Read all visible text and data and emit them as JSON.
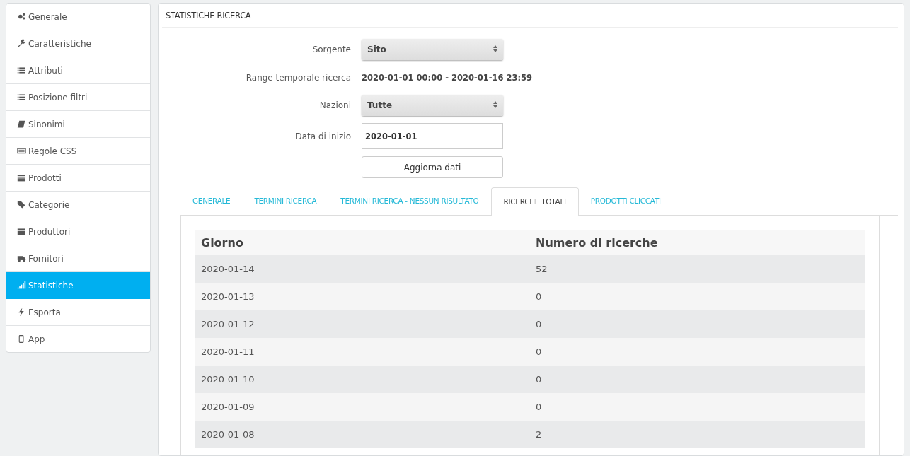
{
  "sidebar": {
    "items": [
      {
        "label": "Generale",
        "selected": false
      },
      {
        "label": "Caratteristiche",
        "selected": false
      },
      {
        "label": "Attributi",
        "selected": false
      },
      {
        "label": "Posizione filtri",
        "selected": false
      },
      {
        "label": "Sinonimi",
        "selected": false
      },
      {
        "label": "Regole CSS",
        "selected": false
      },
      {
        "label": "Prodotti",
        "selected": false
      },
      {
        "label": "Categorie",
        "selected": false
      },
      {
        "label": "Produttori",
        "selected": false
      },
      {
        "label": "Fornitori",
        "selected": false
      },
      {
        "label": "Statistiche",
        "selected": true
      },
      {
        "label": "Esporta",
        "selected": false
      },
      {
        "label": "App",
        "selected": false
      }
    ]
  },
  "panel": {
    "title": "STATISTICHE RICERCA",
    "form": [
      {
        "kind": "select",
        "label": "Sorgente",
        "value": "Sito"
      },
      {
        "kind": "static",
        "label": "Range temporale ricerca",
        "value": "2020-01-01 00:00 - 2020-01-16 23:59"
      },
      {
        "kind": "select",
        "label": "Nazioni",
        "value": "Tutte"
      },
      {
        "kind": "input",
        "label": "Data di inizio",
        "value": "2020-01-01"
      },
      {
        "kind": "button",
        "label": "Aggiorna dati"
      }
    ],
    "tabs": [
      {
        "label": "GENERALE",
        "selected": false
      },
      {
        "label": "TERMINI RICERCA",
        "selected": false
      },
      {
        "label": "TERMINI RICERCA - NESSUN RISULTATO",
        "selected": false
      },
      {
        "label": "RICERCHE TOTALI",
        "selected": true
      },
      {
        "label": "PRODOTTI CLICCATI",
        "selected": false
      }
    ],
    "table": {
      "columns": [
        "Giorno",
        "Numero di ricerche"
      ],
      "rows": [
        [
          "2020-01-14",
          "52"
        ],
        [
          "2020-01-13",
          "0"
        ],
        [
          "2020-01-12",
          "0"
        ],
        [
          "2020-01-11",
          "0"
        ],
        [
          "2020-01-10",
          "0"
        ],
        [
          "2020-01-09",
          "0"
        ],
        [
          "2020-01-08",
          "2"
        ]
      ]
    }
  }
}
